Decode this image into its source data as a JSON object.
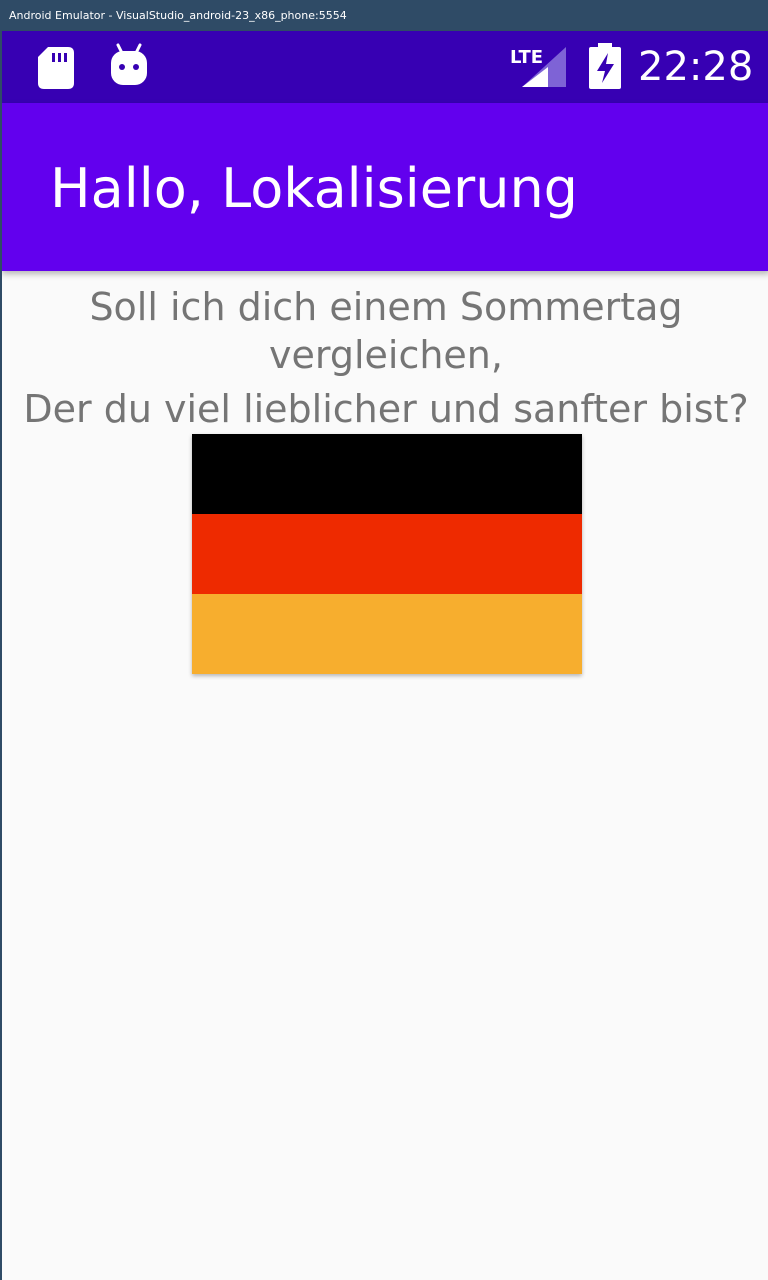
{
  "window": {
    "title": "Android Emulator - VisualStudio_android-23_x86_phone:5554"
  },
  "status_bar": {
    "time": "22:28",
    "network": "LTE",
    "icons": [
      "sd-card-icon",
      "android-debug-icon",
      "lte-signal-icon",
      "battery-charging-icon"
    ],
    "background": "#3700b3"
  },
  "app_bar": {
    "title": "Hallo, Lokalisierung",
    "background": "#6200ee"
  },
  "content": {
    "line1": "Soll ich dich einem Sommertag vergleichen,",
    "line2": "Der du viel lieblicher und sanfter bist?",
    "text_color": "#757575"
  },
  "flag": {
    "name": "germany-flag",
    "colors": [
      "#000000",
      "#ee2a00",
      "#f7ae2e"
    ]
  }
}
